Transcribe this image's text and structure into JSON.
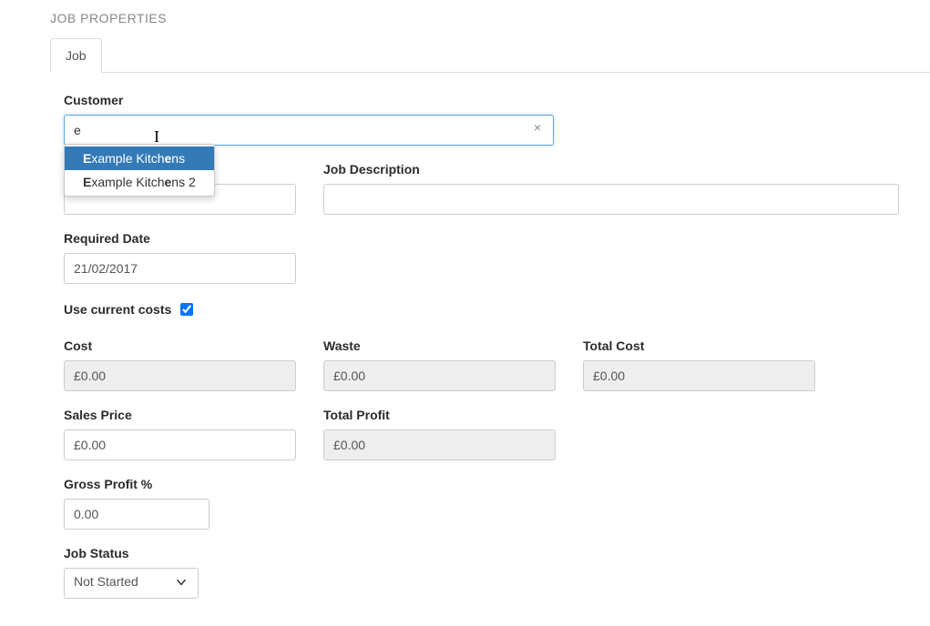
{
  "pageTitle": "JOB PROPERTIES",
  "tabs": {
    "job": "Job"
  },
  "labels": {
    "customer": "Customer",
    "jobDescription": "Job Description",
    "requiredDate": "Required Date",
    "useCurrentCosts": "Use current costs",
    "cost": "Cost",
    "waste": "Waste",
    "totalCost": "Total Cost",
    "salesPrice": "Sales Price",
    "totalProfit": "Total Profit",
    "grossProfitPct": "Gross Profit %",
    "jobStatus": "Job Status"
  },
  "values": {
    "customerInput": "e",
    "requiredDate": "21/02/2017",
    "cost": "£0.00",
    "waste": "£0.00",
    "totalCost": "£0.00",
    "salesPrice": "£0.00",
    "totalProfit": "£0.00",
    "grossProfitPct": "0.00",
    "jobStatus": "Not Started",
    "useCurrentCosts": true
  },
  "autocomplete": {
    "items": [
      {
        "prefix": "E",
        "mid": "xample Kitch",
        "suffix1": "e",
        "suffix2": "ns"
      },
      {
        "prefix": "E",
        "mid": "xample Kitch",
        "suffix1": "e",
        "suffix2": "ns 2"
      }
    ]
  },
  "icons": {
    "clear": "×"
  }
}
